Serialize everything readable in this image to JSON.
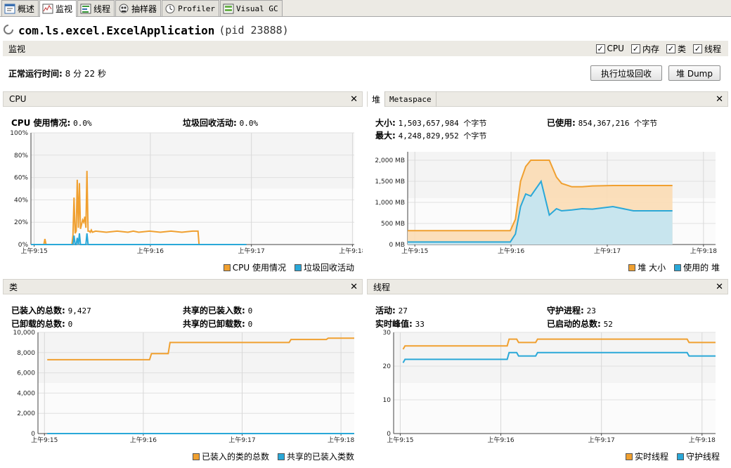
{
  "tabs": [
    {
      "label": "概述",
      "icon": "overview-icon"
    },
    {
      "label": "监视",
      "icon": "monitor-icon"
    },
    {
      "label": "线程",
      "icon": "threads-icon"
    },
    {
      "label": "抽样器",
      "icon": "sampler-icon"
    },
    {
      "label": "Profiler",
      "icon": "profiler-icon"
    },
    {
      "label": "Visual GC",
      "icon": "visualgc-icon"
    }
  ],
  "header": {
    "app_name": "com.ls.excel.ExcelApplication",
    "pid": "(pid 23888)"
  },
  "section": {
    "title": "监视",
    "checks": [
      {
        "label": "CPU",
        "checked": true
      },
      {
        "label": "内存",
        "checked": true
      },
      {
        "label": "类",
        "checked": true
      },
      {
        "label": "线程",
        "checked": true
      }
    ]
  },
  "uptime": {
    "label": "正常运行时间:",
    "value": "8 分 22 秒"
  },
  "buttons": {
    "gc": "执行垃圾回收",
    "heap_dump": "堆 Dump"
  },
  "colors": {
    "orange": "#f0a030",
    "blue": "#2aa8d8",
    "orange_fill": "#fbdcb4",
    "blue_fill": "#c2e6f4"
  },
  "cpu_panel": {
    "title": "CPU",
    "usage_label": "CPU 使用情况:",
    "usage_value": "0.0%",
    "gc_label": "垃圾回收活动:",
    "gc_value": "0.0%",
    "legend": [
      "CPU 使用情况",
      "垃圾回收活动"
    ]
  },
  "heap_panel": {
    "tabs": [
      "堆",
      "Metaspace"
    ],
    "size_label": "大小:",
    "size_value": "1,503,657,984 个字节",
    "max_label": "最大:",
    "max_value": "4,248,829,952 个字节",
    "used_label": "已使用:",
    "used_value": "854,367,216 个字节",
    "legend": [
      "堆 大小",
      "使用的 堆"
    ]
  },
  "classes_panel": {
    "title": "类",
    "loaded_label": "已装入的总数:",
    "loaded_value": "9,427",
    "unloaded_label": "已卸载的总数:",
    "unloaded_value": "0",
    "shared_loaded_label": "共享的已装入数:",
    "shared_loaded_value": "0",
    "shared_unloaded_label": "共享的已卸载数:",
    "shared_unloaded_value": "0",
    "legend": [
      "已装入的类的总数",
      "共享的已装入类数"
    ]
  },
  "threads_panel": {
    "title": "线程",
    "live_label": "活动:",
    "live_value": "27",
    "peak_label": "实时峰值:",
    "peak_value": "33",
    "daemon_label": "守护进程:",
    "daemon_value": "23",
    "started_label": "已启动的总数:",
    "started_value": "52",
    "legend": [
      "实时线程",
      "守护线程"
    ]
  },
  "chart_data": [
    {
      "type": "line",
      "title": "CPU",
      "x_ticks": [
        "上午9:15",
        "上午9:16",
        "上午9:17",
        "上午9:18"
      ],
      "y_ticks": [
        "0%",
        "20%",
        "40%",
        "60%",
        "80%",
        "100%"
      ],
      "ylim": [
        0,
        100
      ],
      "x": [
        0,
        0.12,
        0.13,
        0.14,
        0.38,
        0.39,
        0.4,
        0.41,
        0.42,
        0.43,
        0.44,
        0.45,
        0.46,
        0.47,
        0.48,
        0.49,
        0.5,
        0.51,
        0.52,
        0.53,
        0.54,
        0.55,
        0.56,
        0.57,
        0.6,
        0.7,
        0.8,
        0.9,
        0.95,
        1.0,
        1.1,
        1.2,
        1.3,
        1.4,
        1.5,
        1.55,
        1.56,
        1.6,
        2.0
      ],
      "series": [
        {
          "name": "CPU 使用情况",
          "values": [
            0,
            0,
            5,
            0,
            0,
            8,
            42,
            10,
            12,
            58,
            15,
            55,
            14,
            18,
            22,
            20,
            25,
            15,
            66,
            12,
            12,
            11,
            13,
            11,
            12,
            11,
            12,
            11,
            12,
            11,
            12,
            11,
            12,
            11,
            12,
            12,
            0,
            0,
            0
          ]
        },
        {
          "name": "垃圾回收活动",
          "values": [
            0,
            0,
            0,
            0,
            0,
            0,
            8,
            0,
            0,
            6,
            0,
            10,
            0,
            0,
            0,
            0,
            0,
            0,
            10,
            0,
            0,
            0,
            0,
            0,
            0,
            0,
            0,
            0,
            0,
            0,
            0,
            0,
            0,
            0,
            0,
            0,
            0,
            0,
            0
          ]
        }
      ],
      "grid": true,
      "legend": "bottom-right"
    },
    {
      "type": "area",
      "title": "堆",
      "x_ticks": [
        "上午9:15",
        "上午9:16",
        "上午9:17",
        "上午9:18"
      ],
      "y_ticks": [
        "0 MB",
        "500 MB",
        "1,000 MB",
        "1,500 MB",
        "2,000 MB"
      ],
      "ylim": [
        0,
        2200
      ],
      "x": [
        0,
        0.9,
        1.0,
        1.05,
        1.1,
        1.15,
        1.2,
        1.3,
        1.38,
        1.45,
        1.5,
        1.6,
        1.7,
        1.8,
        2.0,
        2.2,
        2.4,
        2.58
      ],
      "series": [
        {
          "name": "堆 大小",
          "values": [
            330,
            330,
            330,
            600,
            1500,
            1850,
            2000,
            2000,
            2000,
            1600,
            1450,
            1370,
            1370,
            1390,
            1400,
            1400,
            1400,
            1400
          ]
        },
        {
          "name": "使用的 堆",
          "values": [
            60,
            60,
            60,
            250,
            900,
            1200,
            1150,
            1500,
            700,
            850,
            800,
            820,
            850,
            840,
            900,
            800,
            800,
            800
          ]
        }
      ],
      "grid": true,
      "legend": "bottom-right"
    },
    {
      "type": "line",
      "title": "类",
      "x_ticks": [
        "上午9:15",
        "上午9:16",
        "上午9:17",
        "上午9:18"
      ],
      "y_ticks": [
        "0",
        "2,000",
        "4,000",
        "6,000",
        "8,000",
        "10,000"
      ],
      "ylim": [
        0,
        10000
      ],
      "x": [
        0,
        1.1,
        1.12,
        1.3,
        1.32,
        1.6,
        1.62,
        2.6,
        2.62,
        3.0,
        3.02,
        3.3
      ],
      "series": [
        {
          "name": "已装入的类的总数",
          "values": [
            7300,
            7300,
            7900,
            7900,
            9000,
            9000,
            9000,
            9000,
            9300,
            9300,
            9427,
            9427
          ]
        },
        {
          "name": "共享的已装入类数",
          "values": [
            0,
            0,
            0,
            0,
            0,
            0,
            0,
            0,
            0,
            0,
            0,
            0
          ]
        }
      ],
      "grid": true,
      "legend": "bottom-right"
    },
    {
      "type": "line",
      "title": "线程",
      "x_ticks": [
        "上午9:15",
        "上午9:16",
        "上午9:17",
        "上午9:18"
      ],
      "y_ticks": [
        "0",
        "10",
        "20",
        "30"
      ],
      "ylim": [
        0,
        30
      ],
      "x": [
        0,
        0.02,
        1.1,
        1.12,
        1.2,
        1.22,
        1.4,
        1.42,
        3.0,
        3.02,
        3.3
      ],
      "series": [
        {
          "name": "实时线程",
          "values": [
            25,
            26,
            26,
            28,
            28,
            27,
            27,
            28,
            28,
            27,
            27
          ]
        },
        {
          "name": "守护线程",
          "values": [
            21,
            22,
            22,
            24,
            24,
            23,
            23,
            24,
            24,
            23,
            23
          ]
        }
      ],
      "grid": true,
      "legend": "bottom-right"
    }
  ]
}
